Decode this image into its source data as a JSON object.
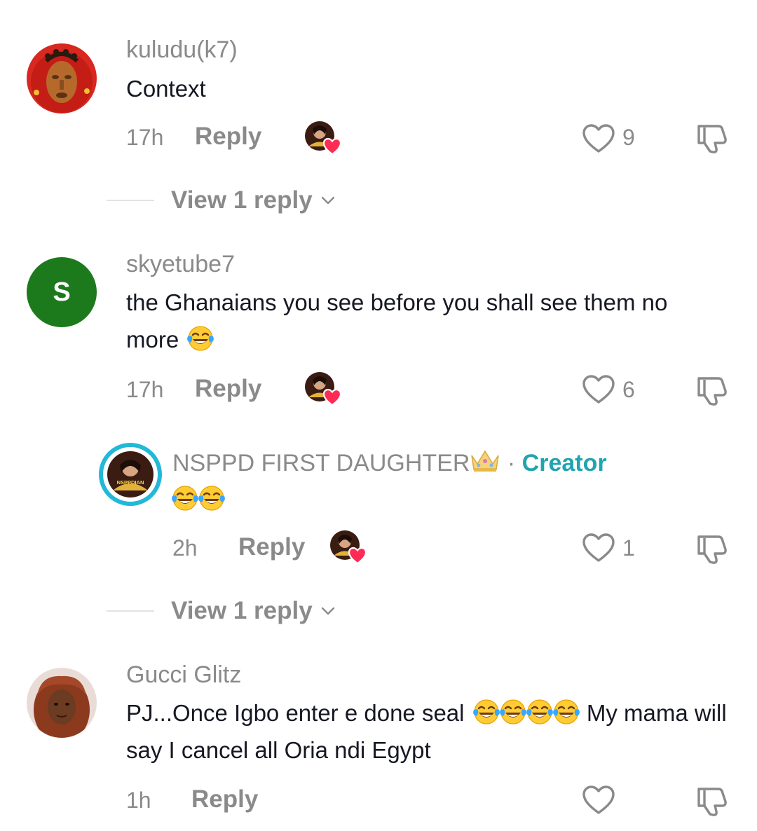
{
  "comments": [
    {
      "username": "kuludu(k7)",
      "text": "Context",
      "time": "17h",
      "reply_label": "Reply",
      "likes": "9",
      "view_replies": "View 1 reply"
    },
    {
      "username": "skyetube7",
      "avatar_letter": "S",
      "text": "the Ghanaians you see before you shall see them no more",
      "time": "17h",
      "reply_label": "Reply",
      "likes": "6"
    },
    {
      "username": "NSPPD FIRST DAUGHTER",
      "creator_sep": "·",
      "creator_badge": "Creator",
      "time": "2h",
      "reply_label": "Reply",
      "likes": "1",
      "view_replies": "View 1 reply",
      "avatar_caption": "NSPPDIAN"
    },
    {
      "username": "Gucci Glitz",
      "text_part1": "PJ...Once Igbo enter e done seal",
      "text_part2": "My mama will say I cancel all Oria ndi Egypt",
      "time": "1h",
      "reply_label": "Reply"
    }
  ],
  "colors": {
    "creator_accent": "#20a4b0",
    "heart_badge": "#fe2c55",
    "muted": "#8a8a8a",
    "text": "#161823",
    "skyetube_avatar": "#1c7a1c"
  },
  "icons": [
    "heart-outline-icon",
    "dislike-icon",
    "chevron-down-icon",
    "tears-of-joy-emoji",
    "crown-emoji",
    "creator-liked-badge"
  ]
}
